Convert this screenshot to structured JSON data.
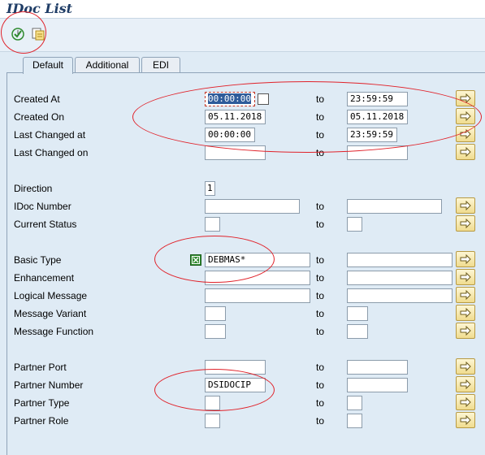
{
  "window": {
    "title": "IDoc List"
  },
  "toolbar": {
    "execute_icon": "execute-icon",
    "variant_icon": "get-variant-icon"
  },
  "tabs": [
    {
      "label": "Default",
      "active": true
    },
    {
      "label": "Additional",
      "active": false
    },
    {
      "label": "EDI",
      "active": false
    }
  ],
  "to_label": "to",
  "fields": {
    "created_at": {
      "label": "Created At",
      "from": "00:00:00",
      "to": "23:59:59"
    },
    "created_on": {
      "label": "Created On",
      "from": "05.11.2018",
      "to": "05.11.2018"
    },
    "last_changed_at": {
      "label": "Last Changed at",
      "from": "00:00:00",
      "to": "23:59:59"
    },
    "last_changed_on": {
      "label": "Last Changed on",
      "from": "",
      "to": ""
    },
    "direction": {
      "label": "Direction",
      "value": "1"
    },
    "idoc_number": {
      "label": "IDoc Number",
      "from": "",
      "to": ""
    },
    "current_status": {
      "label": "Current Status",
      "from": "",
      "to": ""
    },
    "basic_type": {
      "label": "Basic Type",
      "from": "DEBMAS*",
      "to": ""
    },
    "enhancement": {
      "label": "Enhancement",
      "from": "",
      "to": ""
    },
    "logical_message": {
      "label": "Logical Message",
      "from": "",
      "to": ""
    },
    "message_variant": {
      "label": "Message Variant",
      "from": "",
      "to": ""
    },
    "message_function": {
      "label": "Message Function",
      "from": "",
      "to": ""
    },
    "partner_port": {
      "label": "Partner Port",
      "from": "",
      "to": ""
    },
    "partner_number": {
      "label": "Partner Number",
      "from": "DSIDOCIP",
      "to": ""
    },
    "partner_type": {
      "label": "Partner Type",
      "from": "",
      "to": ""
    },
    "partner_role": {
      "label": "Partner Role",
      "from": "",
      "to": ""
    }
  },
  "colors": {
    "annotation": "#e0232b",
    "background": "#dfebf5",
    "title": "#1f3d66"
  }
}
